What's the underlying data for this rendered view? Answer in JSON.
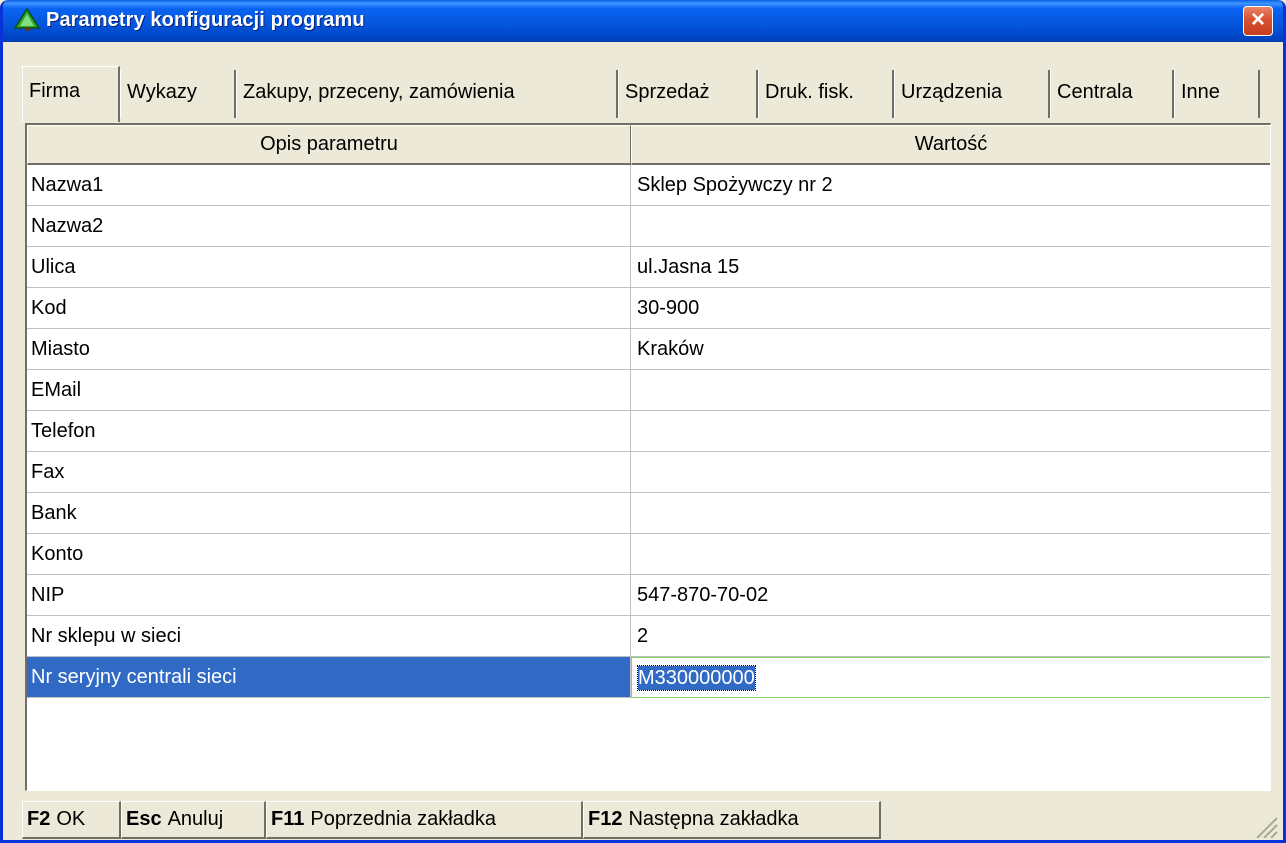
{
  "window": {
    "title": "Parametry konfiguracji programu",
    "close_glyph": "×",
    "icon": "green-tree-icon",
    "title_bar_color": "#0A5FE8"
  },
  "tabs": [
    {
      "label": "Firma",
      "active": true
    },
    {
      "label": "Wykazy",
      "active": false
    },
    {
      "label": "Zakupy, przeceny, zamówienia",
      "active": false
    },
    {
      "label": "Sprzedaż",
      "active": false
    },
    {
      "label": "Druk. fisk.",
      "active": false
    },
    {
      "label": "Urządzenia",
      "active": false
    },
    {
      "label": "Centrala",
      "active": false
    },
    {
      "label": "Inne",
      "active": false
    }
  ],
  "grid": {
    "headers": {
      "description": "Opis parametru",
      "value": "Wartość"
    },
    "rows": [
      {
        "description": "Nazwa1",
        "value": "Sklep Spożywczy nr 2"
      },
      {
        "description": "Nazwa2",
        "value": ""
      },
      {
        "description": "Ulica",
        "value": "ul.Jasna 15"
      },
      {
        "description": "Kod",
        "value": "30-900"
      },
      {
        "description": "Miasto",
        "value": "Kraków"
      },
      {
        "description": "EMail",
        "value": ""
      },
      {
        "description": "Telefon",
        "value": ""
      },
      {
        "description": "Fax",
        "value": ""
      },
      {
        "description": "Bank",
        "value": ""
      },
      {
        "description": "Konto",
        "value": ""
      },
      {
        "description": "NIP",
        "value": "547-870-70-02"
      },
      {
        "description": "Nr sklepu w sieci",
        "value": "2"
      },
      {
        "description": "Nr seryjny centrali sieci",
        "value": "M330000000",
        "selected": true
      }
    ],
    "selection_color": "#316AC5"
  },
  "statusbar": {
    "keys": [
      {
        "key": "F2",
        "label": "OK"
      },
      {
        "key": "Esc",
        "label": "Anuluj"
      },
      {
        "key": "F11",
        "label": "Poprzednia zakładka"
      },
      {
        "key": "F12",
        "label": "Następna zakładka"
      }
    ]
  }
}
